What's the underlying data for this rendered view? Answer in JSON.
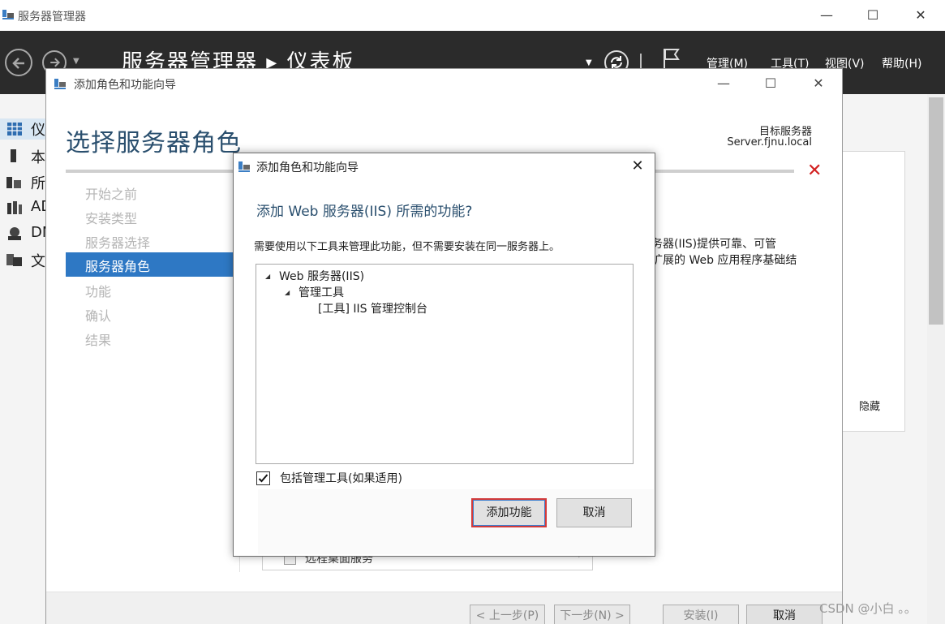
{
  "server_manager": {
    "window_title": "服务器管理器",
    "breadcrumb": "服务器管理器 ▸ 仪表板",
    "menu": {
      "manage": "管理(M)",
      "tools": "工具(T)",
      "view": "视图(V)",
      "help": "帮助(H)"
    },
    "sidebar": [
      {
        "label": "仪",
        "icon": "dashboard-icon"
      },
      {
        "label": "本",
        "icon": "local-server-icon"
      },
      {
        "label": "所",
        "icon": "all-servers-icon"
      },
      {
        "label": "AD",
        "icon": "ad-icon"
      },
      {
        "label": "DN",
        "icon": "dns-icon"
      },
      {
        "label": "文",
        "icon": "file-services-icon"
      }
    ],
    "hide_label": "隐藏"
  },
  "wizard": {
    "title": "添加角色和功能向导",
    "heading": "选择服务器角色",
    "target_label": "目标服务器",
    "target_server": "Server.fjnu.local",
    "steps": [
      "开始之前",
      "安装类型",
      "服务器选择",
      "服务器角色",
      "功能",
      "确认",
      "结果"
    ],
    "active_step": "服务器角色",
    "description_lines": [
      "务器(IIS)提供可靠、可管",
      "扩展的 Web 应用程序基础结"
    ],
    "behind_item": "远程桌面服务",
    "buttons": {
      "prev": "< 上一步(P)",
      "next": "下一步(N) >",
      "install": "安装(I)",
      "cancel": "取消"
    }
  },
  "dialog": {
    "title": "添加角色和功能向导",
    "heading": "添加 Web 服务器(IIS) 所需的功能?",
    "message": "需要使用以下工具来管理此功能，但不需要安装在同一服务器上。",
    "tree": [
      {
        "label": "Web 服务器(IIS)",
        "level": 0,
        "expanded": true
      },
      {
        "label": "管理工具",
        "level": 1,
        "expanded": true
      },
      {
        "label": "[工具] IIS 管理控制台",
        "level": 2,
        "expanded": false
      }
    ],
    "checkbox_label": "包括管理工具(如果适用)",
    "checkbox_checked": true,
    "add_button": "添加功能",
    "cancel_button": "取消"
  },
  "watermark": "CSDN @小白 。。",
  "colors": {
    "header_bg": "#2b2b2b",
    "heading_blue": "#2a4f6e",
    "active_step": "#2e78c4",
    "error_red": "#d22020"
  }
}
